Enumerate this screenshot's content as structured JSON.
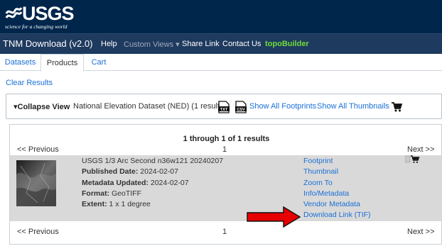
{
  "header": {
    "logo_text": "USGS",
    "tagline": "science for a changing world"
  },
  "nav": {
    "brand": "TNM Download (v2.0)",
    "items": [
      {
        "label": "Help",
        "style": "normal"
      },
      {
        "label": "Custom Views ▾",
        "style": "muted"
      },
      {
        "label": "Share Link",
        "style": "normal"
      },
      {
        "label": "Contact Us",
        "style": "normal"
      },
      {
        "label": "topoBuilder",
        "style": "green"
      }
    ]
  },
  "tabs": [
    {
      "label": "Datasets",
      "active": false
    },
    {
      "label": "Products",
      "active": true
    },
    {
      "label": "Cart",
      "active": false
    }
  ],
  "clear_results": "Clear Results",
  "view_box": {
    "collapse_label": "▾Collapse View",
    "dataset": "National Elevation Dataset (NED) (1 results)",
    "txt_icon": "TXT",
    "csv_icon": "CSV",
    "show_footprints": "Show All Footprints",
    "show_thumbnails": "Show All Thumbnails"
  },
  "results": {
    "range_text": "1 through 1 of 1 results",
    "prev": "<< Previous",
    "next": "Next >>",
    "page": "1",
    "item": {
      "title": "USGS 1/3 Arc Second n36w121 20240207",
      "published_label": "Published Date:",
      "published_value": "2024-02-07",
      "metadata_label": "Metadata Updated:",
      "metadata_value": "2024-02-07",
      "format_label": "Format:",
      "format_value": "GeoTIFF",
      "extent_label": "Extent:",
      "extent_value": "1 x 1 degree",
      "links": {
        "footprint": "Footprint",
        "thumbnail": "Thumbnail",
        "zoom_to": "Zoom To",
        "info_metadata": "Info/Metadata",
        "vendor_metadata": "Vendor Metadata",
        "download": "Download Link (TIF)"
      }
    }
  },
  "colors": {
    "header_bg": "#00264c",
    "nav_bg": "#1f3a5f",
    "link": "#1a6fd6",
    "highlight_green": "#6fdc3a",
    "result_row_bg": "#d9d9d9",
    "arrow_red": "#e60000"
  },
  "icons": [
    "usgs-logo-icon",
    "txt-file-icon",
    "csv-file-icon",
    "cart-icon",
    "red-arrow-icon"
  ]
}
